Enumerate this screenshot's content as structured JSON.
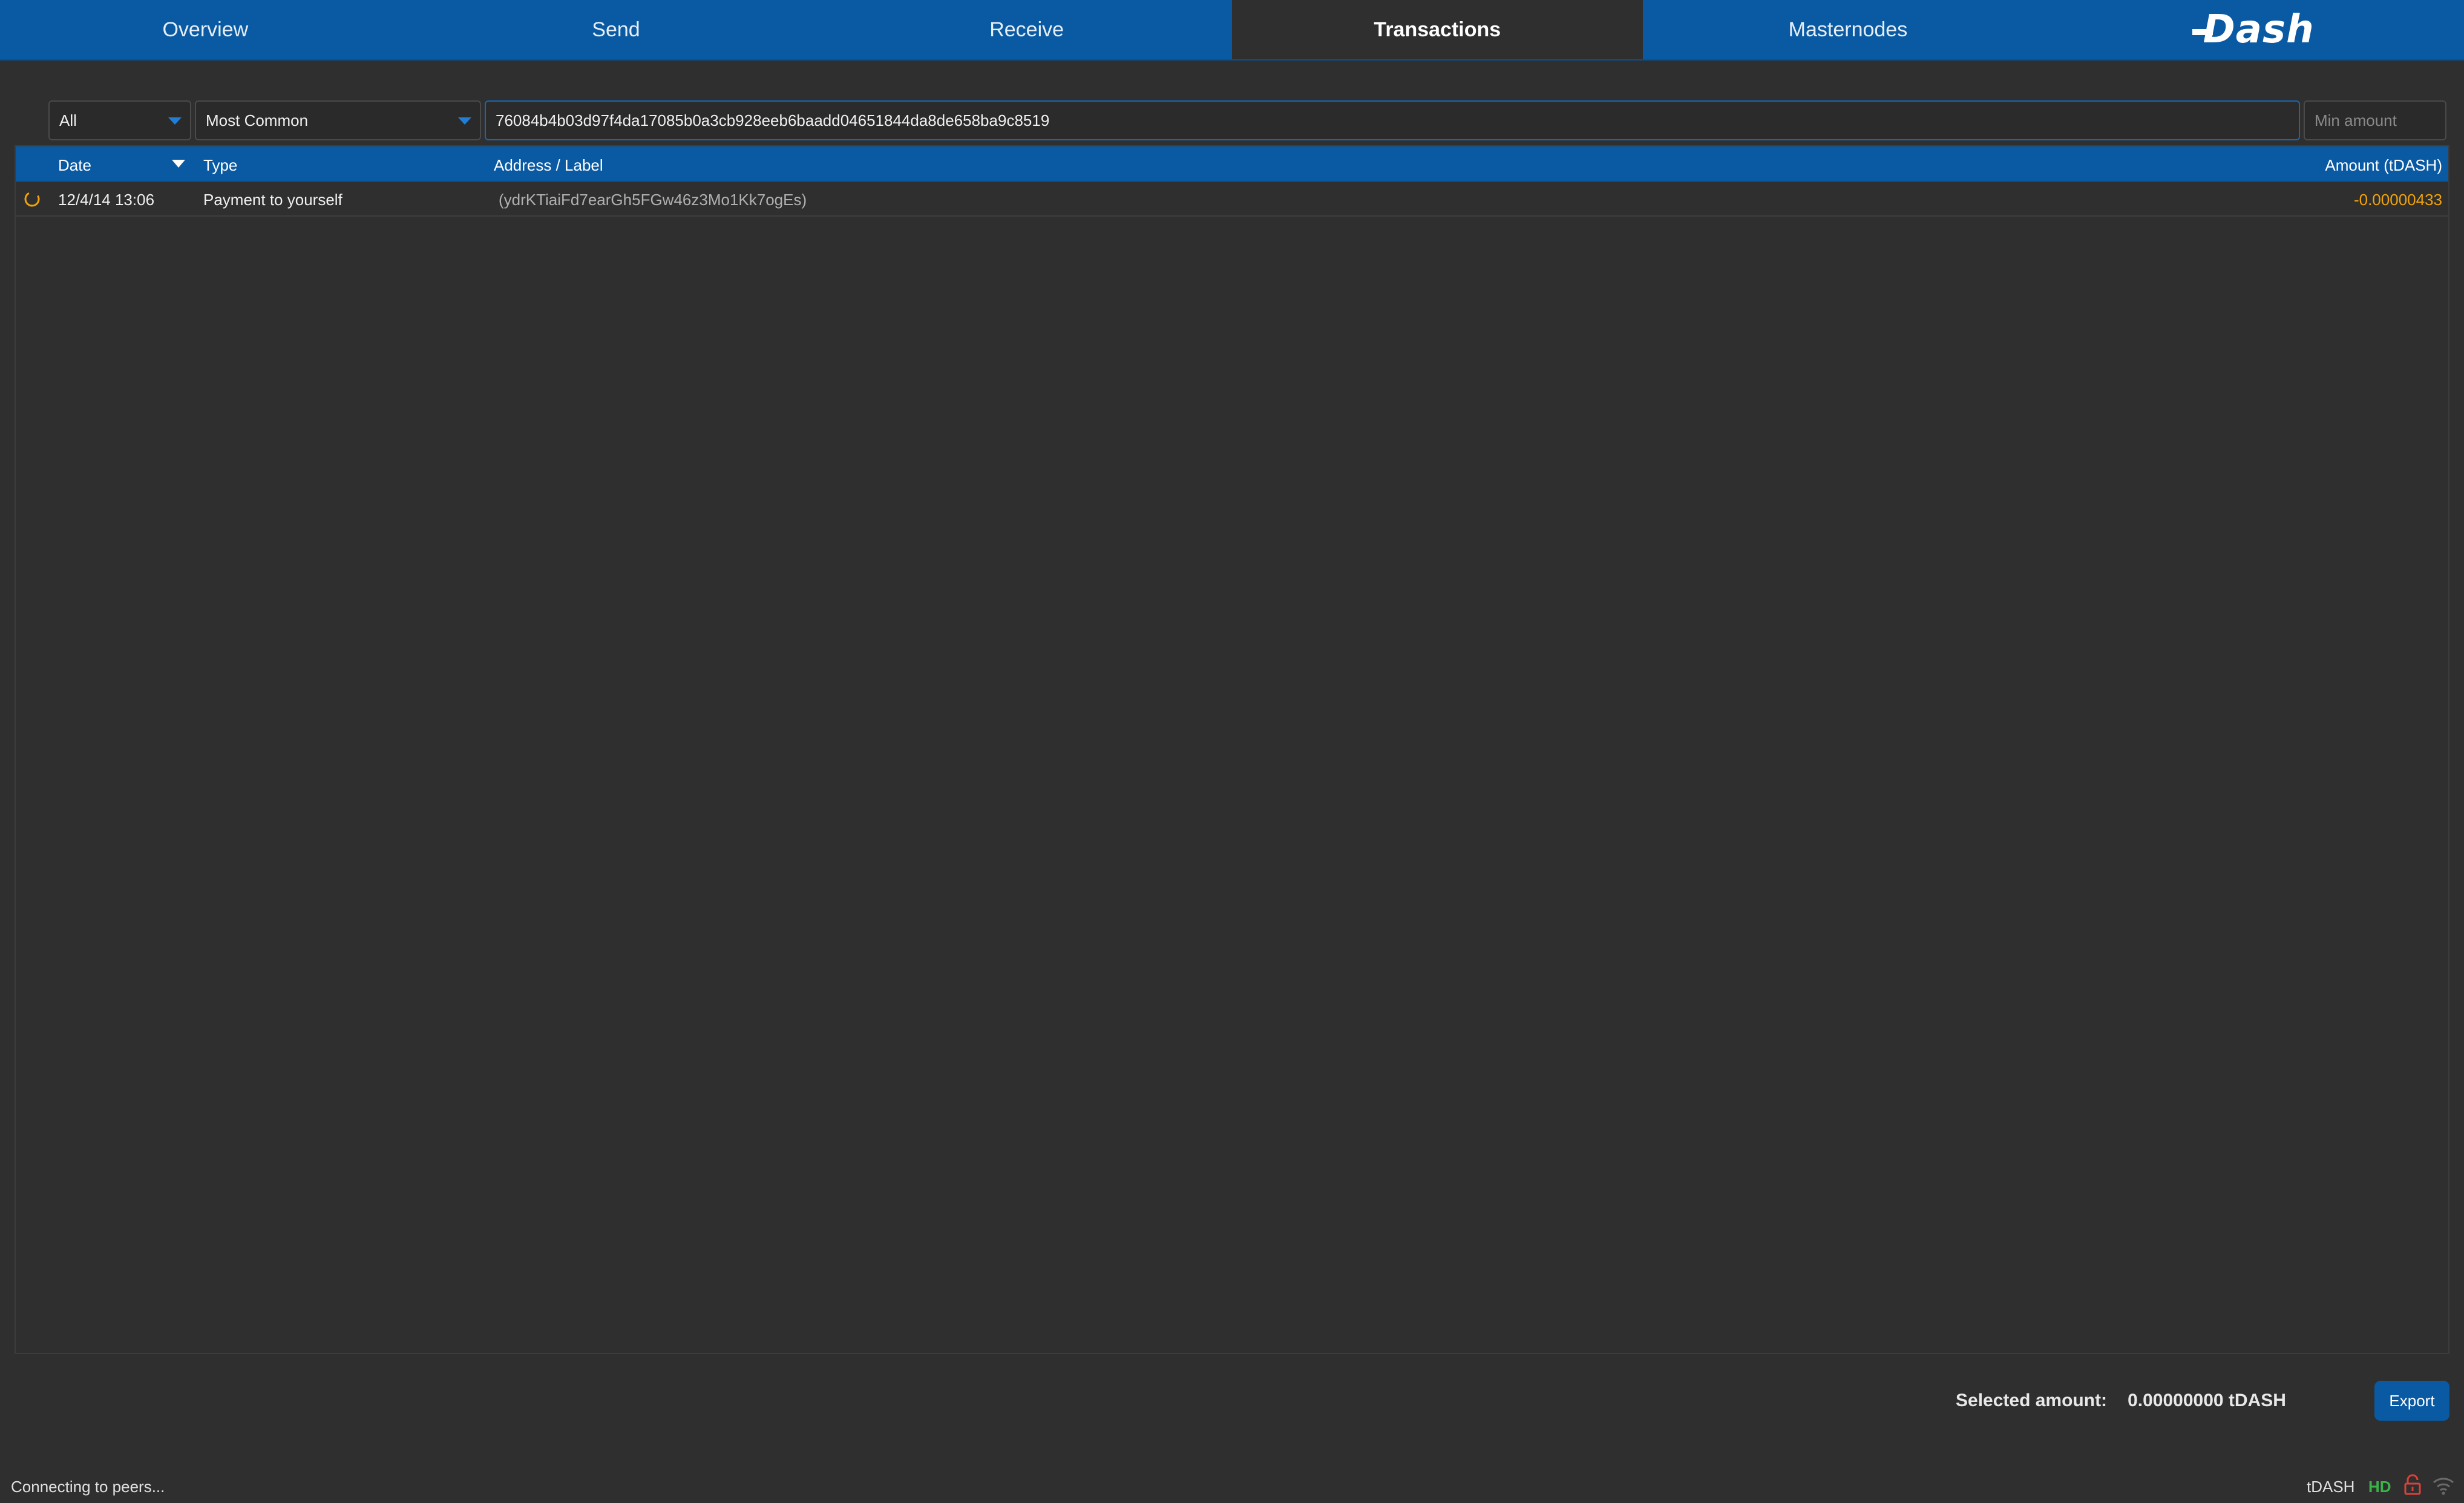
{
  "nav": {
    "tabs": [
      {
        "label": "Overview"
      },
      {
        "label": "Send"
      },
      {
        "label": "Receive"
      },
      {
        "label": "Transactions",
        "active": true
      },
      {
        "label": "Masternodes"
      }
    ],
    "logo_text": "Dash"
  },
  "filters": {
    "date_filter": "All",
    "type_filter": "Most Common",
    "search_value": "76084b4b03d97f4da17085b0a3cb928eeb6baadd04651844da8de658ba9c8519",
    "min_amount_placeholder": "Min amount"
  },
  "table": {
    "columns": {
      "date": "Date",
      "type": "Type",
      "address": "Address / Label",
      "amount": "Amount (tDASH)"
    },
    "sort_column": "Date",
    "rows": [
      {
        "status_icon": "unconfirmed-spinner-icon",
        "date": "12/4/14 13:06",
        "type": "Payment to yourself",
        "address": "(ydrKTiaiFd7earGh5FGw46z3Mo1Kk7ogEs)",
        "amount": "-0.00000433"
      }
    ]
  },
  "footer": {
    "selected_label": "Selected amount:",
    "selected_value": "0.00000000 tDASH",
    "export_label": "Export"
  },
  "statusbar": {
    "status_text": "Connecting to peers...",
    "unit": "tDASH",
    "hd_label": "HD",
    "icons": [
      "wallet-unlocked-icon",
      "network-signal-icon"
    ]
  },
  "colors": {
    "accent": "#0a5aa3",
    "background": "#2f2f2f",
    "negative_amount": "#f0a30a",
    "hd_green": "#3cb34a",
    "lock_red": "#d9423a"
  }
}
